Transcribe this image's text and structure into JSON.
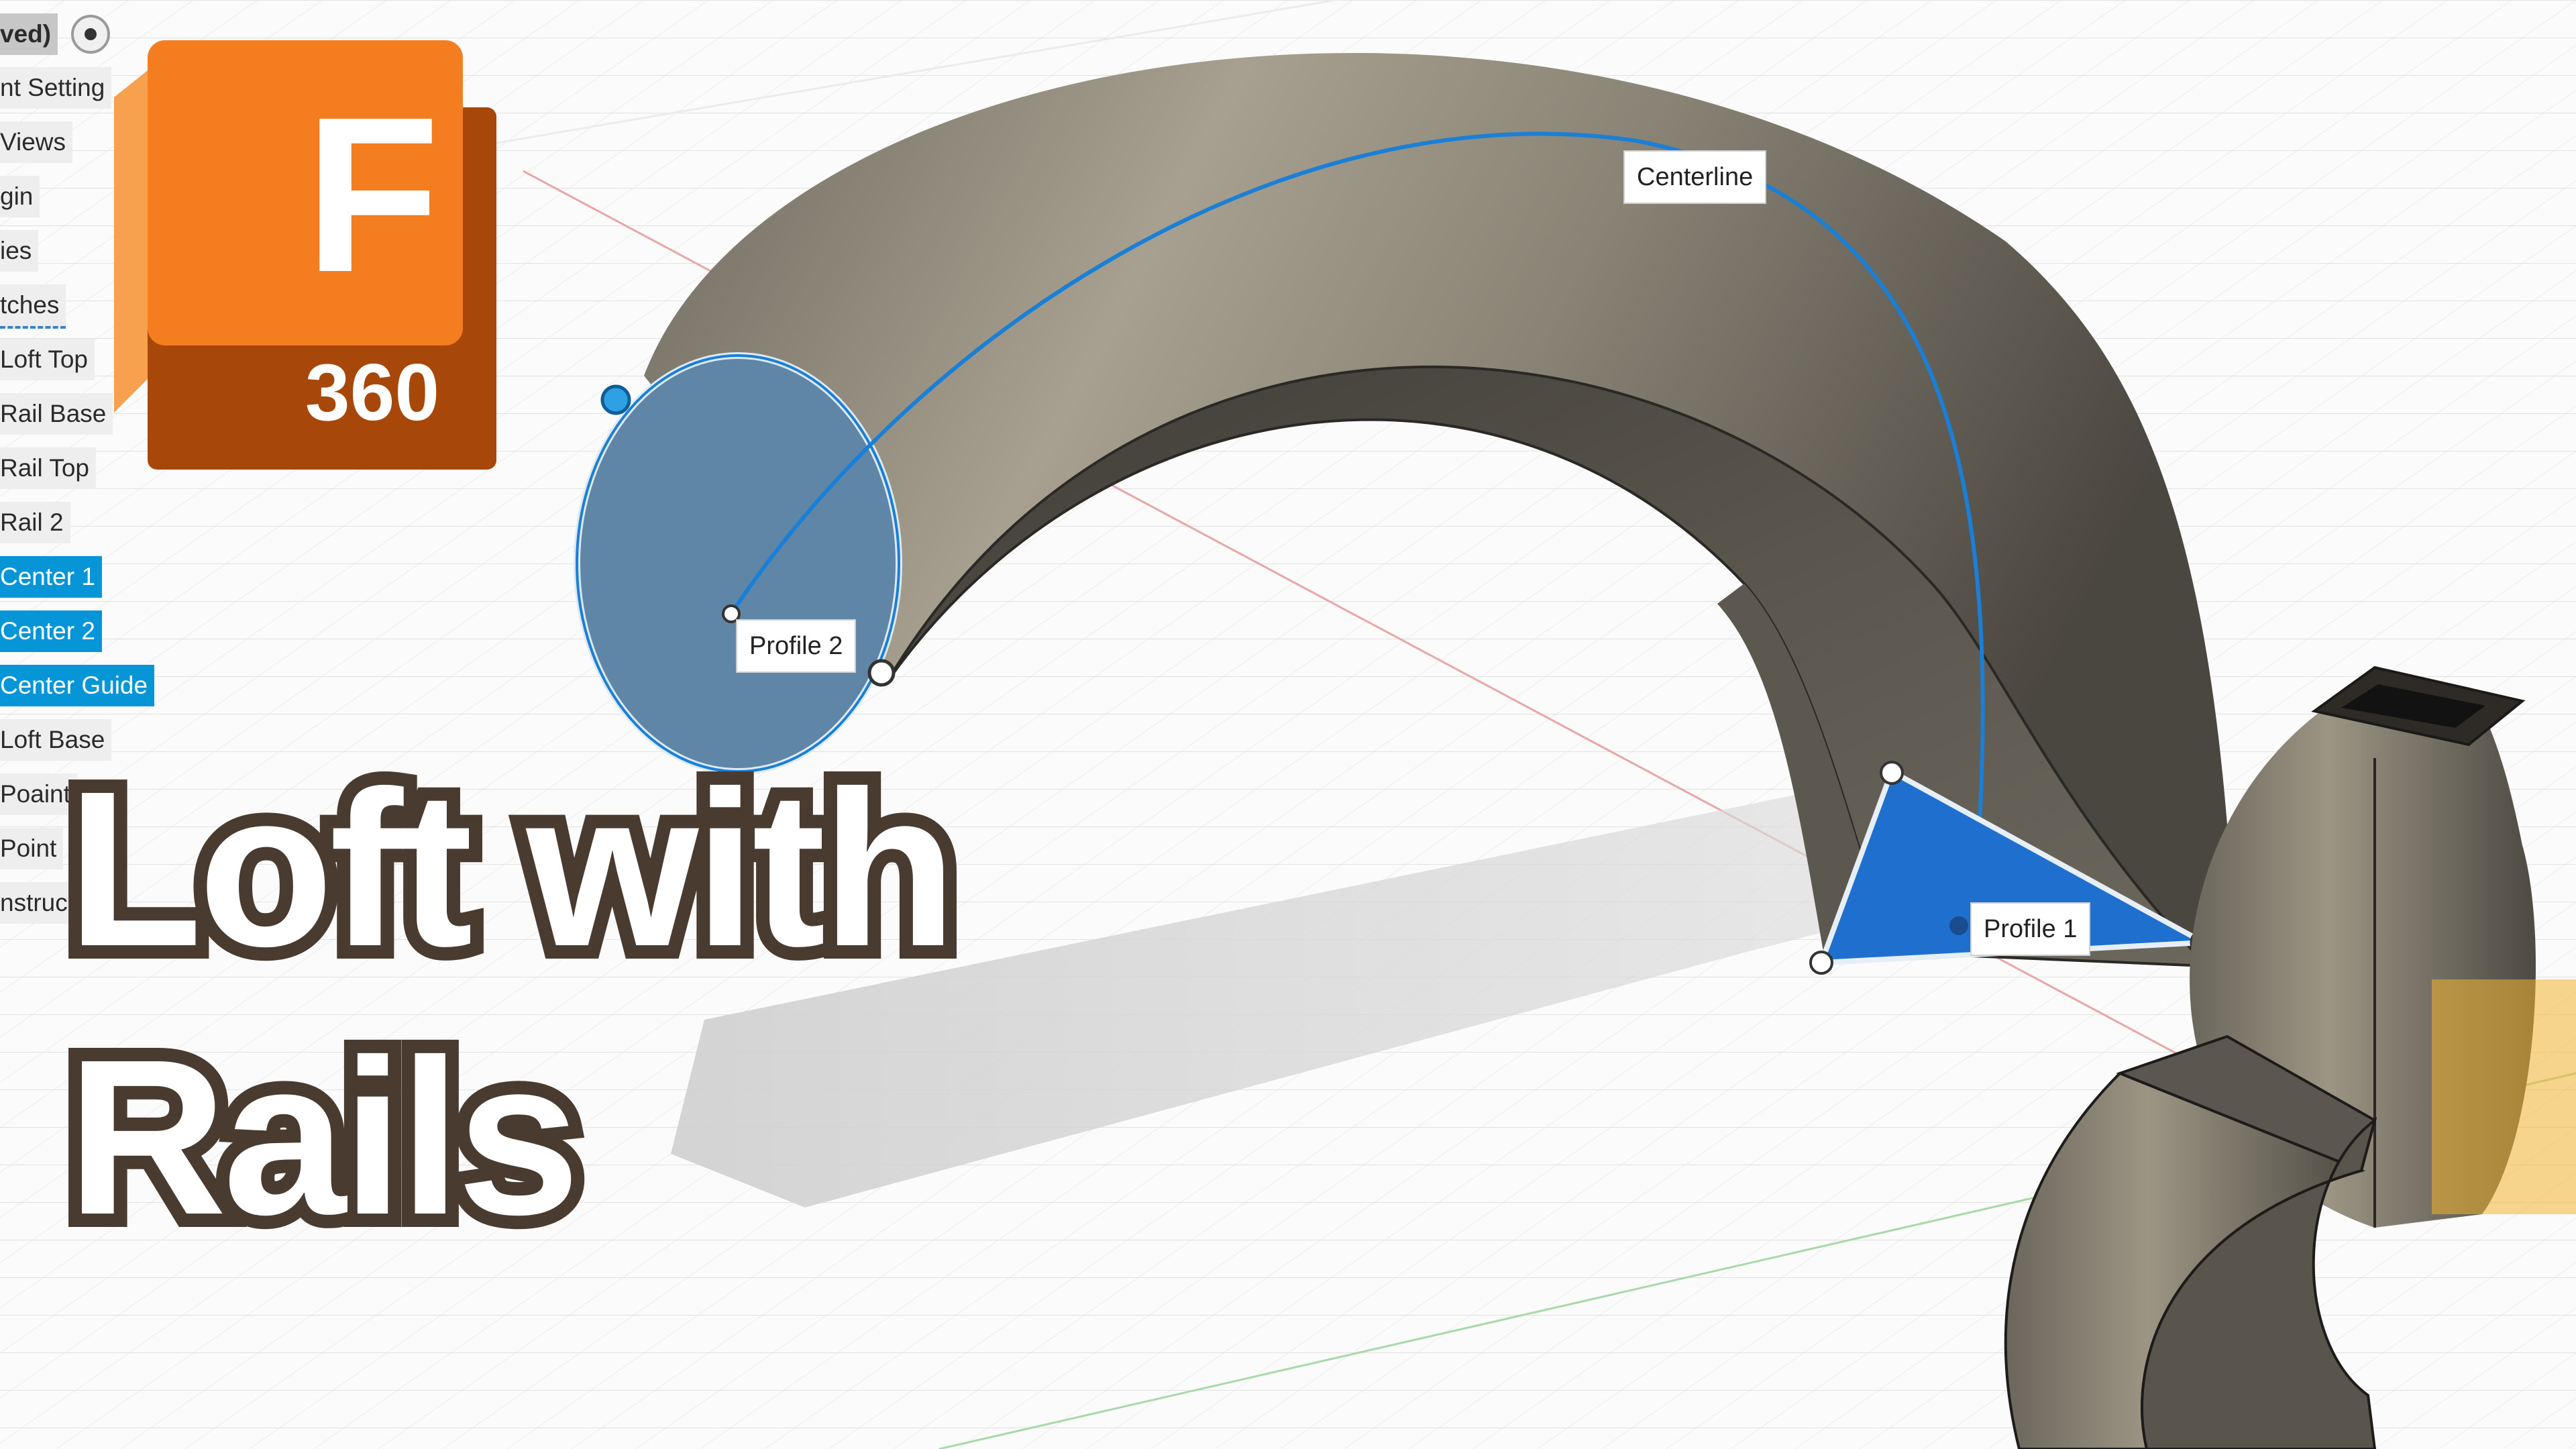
{
  "browser": {
    "top_item": "ved)",
    "items": [
      {
        "label": "nt Setting",
        "selected": false
      },
      {
        "label": "Views",
        "selected": false
      },
      {
        "label": "gin",
        "selected": false
      },
      {
        "label": "ies",
        "selected": false
      },
      {
        "label": "tches",
        "selected": false
      },
      {
        "label": "Loft Top",
        "selected": false
      },
      {
        "label": "Rail Base",
        "selected": false
      },
      {
        "label": "Rail Top",
        "selected": false
      },
      {
        "label": "Rail 2",
        "selected": false
      },
      {
        "label": "Center 1",
        "selected": true
      },
      {
        "label": "Center 2",
        "selected": true
      },
      {
        "label": "Center Guide",
        "selected": true
      },
      {
        "label": "Loft Base",
        "selected": false
      },
      {
        "label": "Poaint",
        "selected": false
      },
      {
        "label": "Point",
        "selected": false
      },
      {
        "label": "nstruc",
        "selected": false
      }
    ]
  },
  "logo": {
    "letter": "F",
    "number": "360"
  },
  "callouts": {
    "centerline": "Centerline",
    "profile_2": "Profile 2",
    "profile_1": "Profile 1"
  },
  "headline": {
    "line1": "Loft with",
    "line2": "Rails"
  },
  "colors": {
    "selection_blue": "#0696d7",
    "logo_orange": "#f47d1f",
    "logo_dark": "#b24d0c",
    "headline_outline": "#4a3b30"
  }
}
